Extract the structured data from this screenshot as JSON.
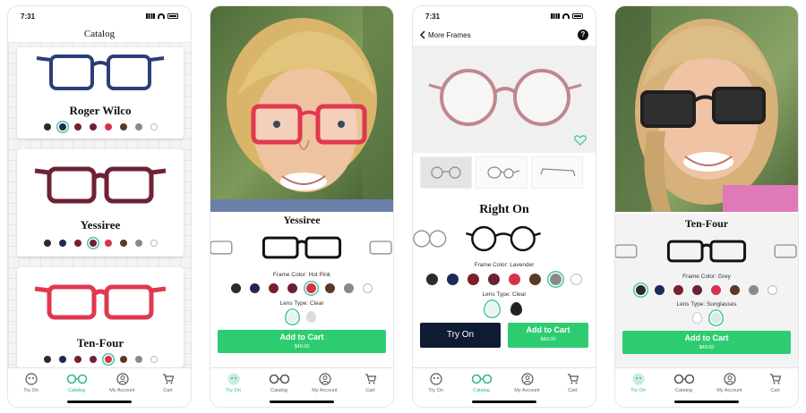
{
  "status_time": "7:31",
  "colors": {
    "navy": "#2c3e7a",
    "plum": "#6e2233",
    "pink": "#e0384f",
    "green": "#2ecc71",
    "lavender": "#c2868f",
    "grey": "#2a2a2a",
    "accent": "#48c79a"
  },
  "swatch_colors": [
    "#2b2b2b",
    "#1e2a55",
    "#7a1f2b",
    "#6b2233",
    "#d8324b",
    "#5b3a24",
    "#8a8a8a",
    "#ffffff"
  ],
  "screen1": {
    "title": "Catalog",
    "cards": [
      {
        "name": "Roger Wilco",
        "frame_color": "#2c3e7a",
        "selected_swatch": 1
      },
      {
        "name": "Yessiree",
        "frame_color": "#6e2233",
        "selected_swatch": 3
      },
      {
        "name": "Ten-Four",
        "frame_color": "#e0384f",
        "selected_swatch": 4
      }
    ]
  },
  "screen2": {
    "frame_name": "Yessiree",
    "frame_color_label": "Frame Color: Hot Pink",
    "lens_type_label": "Lens Type: Clear",
    "selected_swatch": 4,
    "cart_label": "Add to Cart",
    "price": "$49.00"
  },
  "screen3": {
    "back_label": "More Frames",
    "help_label": "?",
    "frame_name": "Right On",
    "frame_color_label": "Frame Color: Lavender",
    "lens_type_label": "Lens Type: Clear",
    "selected_swatch": 6,
    "try_on_label": "Try On",
    "cart_label": "Add to Cart",
    "price": "$49.00"
  },
  "screen4": {
    "frame_name": "Ten-Four",
    "frame_color_label": "Frame Color: Grey",
    "lens_type_label": "Lens Type: Sunglasses",
    "selected_swatch": 0,
    "cart_label": "Add to Cart",
    "price": "$49.00"
  },
  "tabs": [
    "Try On",
    "Catalog",
    "My Account",
    "Cart"
  ]
}
